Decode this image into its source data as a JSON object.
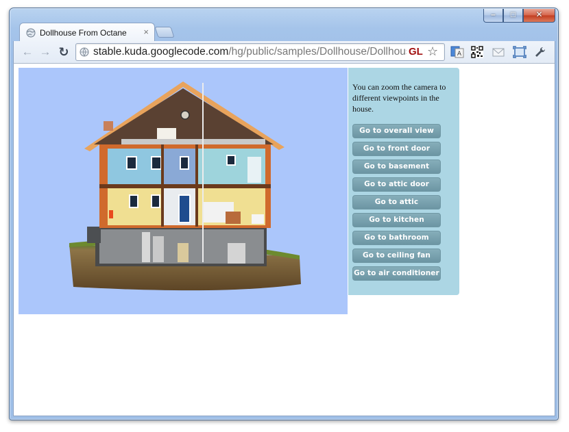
{
  "browser": {
    "tab_title": "Dollhouse From Octane",
    "tab_close": "×",
    "url_host": "stable.kuda.googlecode.com",
    "url_path": "/hg/public/samples/Dollhouse/Dollhouse",
    "gl_badge": "GL",
    "window_controls": {
      "minimize": "–",
      "maximize": "□",
      "close": "✕"
    }
  },
  "panel": {
    "intro": "You can zoom the camera to different viewpoints in the house.",
    "buttons": [
      "Go to overall view",
      "Go to front door",
      "Go to basement",
      "Go to attic door",
      "Go to attic",
      "Go to kitchen",
      "Go to bathroom",
      "Go to ceiling fan",
      "Go to air conditioner"
    ]
  },
  "colors": {
    "scene_background": "#abc6fb",
    "panel_background": "#acd6e4",
    "button_background": "#7aa3b0"
  },
  "icons": [
    "globe-icon",
    "back-arrow-icon",
    "forward-arrow-icon",
    "reload-icon",
    "star-icon",
    "translate-icon",
    "qr-code-icon",
    "mail-icon",
    "fullscreen-icon",
    "wrench-icon"
  ]
}
